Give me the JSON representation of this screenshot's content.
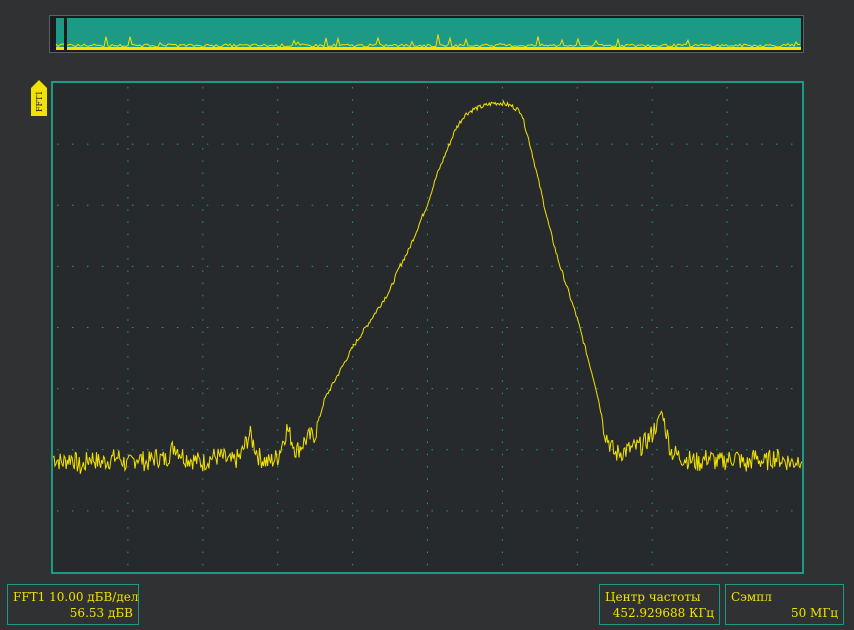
{
  "channel": {
    "label": "FFT1"
  },
  "panels": {
    "fft": {
      "line1": "FFT1  10.00 дБВ/дел",
      "line2": "56.53 дБВ"
    },
    "center": {
      "line1": "Центр частоты",
      "line2": "452.929688 КГц"
    },
    "sample": {
      "line1": "Сэмпл",
      "line2": "50 МГц"
    }
  },
  "colors": {
    "trace": "#f2e200",
    "grid": "#1d9a86",
    "screen_bg": "#262a2c",
    "overview_fill": "#1d9a86",
    "window_bg": "#2f3133"
  },
  "chart_data": {
    "type": "line",
    "title": "",
    "xlabel": "",
    "ylabel": "",
    "divisions": {
      "x": 10,
      "y": 8
    },
    "units_per_div": "10.00 дБВ/дел",
    "series": [
      {
        "values": [
          -6.0,
          -6.1,
          -6.0,
          -6.2,
          -6.0,
          -6.1,
          -6.05,
          -6.0,
          -6.15,
          -6.0,
          -6.1,
          -6.0,
          -6.05,
          -5.8,
          -6.0,
          -6.05,
          -6.1,
          -6.0,
          -6.0,
          -6.1,
          -6.0,
          -5.6,
          -6.0,
          -6.1,
          -6.0,
          -5.5,
          -5.9,
          -5.7,
          -5.6,
          -5.0,
          -4.7,
          -4.4,
          -4.1,
          -3.85,
          -3.6,
          -3.35,
          -3.1,
          -2.7,
          -2.4,
          -2.0,
          -1.6,
          -1.1,
          -0.7,
          -0.3,
          -0.05,
          0.05,
          0.1,
          0.15,
          0.15,
          0.1,
          0.0,
          -0.6,
          -1.3,
          -2.0,
          -2.6,
          -3.1,
          -3.6,
          -4.2,
          -4.8,
          -5.6,
          -5.95,
          -5.9,
          -5.85,
          -5.8,
          -5.6,
          -5.2,
          -5.9,
          -6.0,
          -6.05,
          -6.1,
          -6.0,
          -6.1,
          -6.05,
          -6.0,
          -6.15,
          -6.0,
          -6.1,
          -6.0,
          -6.05,
          -6.1,
          -6.0
        ],
        "ymin": -8,
        "ymax": 0.5
      }
    ],
    "grid": true
  }
}
